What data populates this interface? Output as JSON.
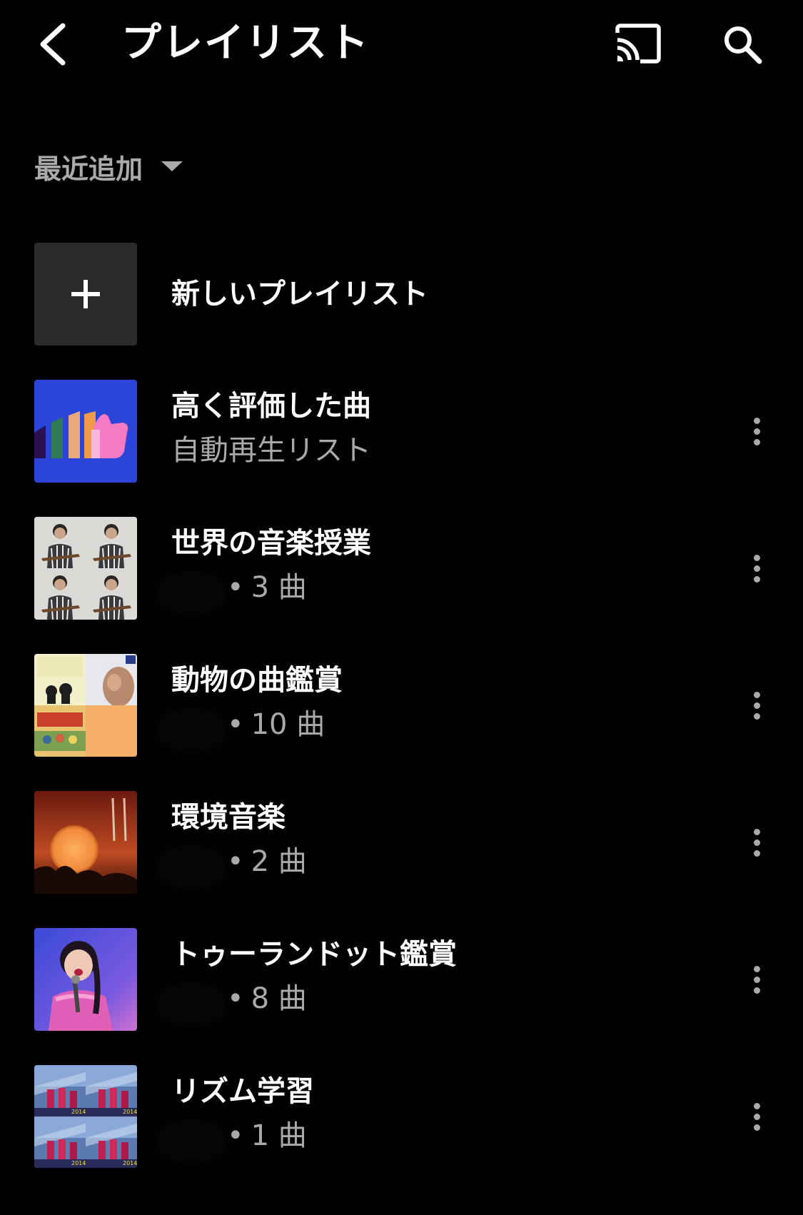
{
  "header": {
    "title": "プレイリスト",
    "back_icon": "back-arrow-icon",
    "cast_icon": "cast-icon",
    "search_icon": "search-icon"
  },
  "sort": {
    "label": "最近追加",
    "icon": "dropdown-caret-icon"
  },
  "new_playlist": {
    "label": "新しいプレイリスト",
    "icon": "plus-icon"
  },
  "playlists": [
    {
      "title": "高く評価した曲",
      "subtitle": "自動再生リスト",
      "owner": "",
      "count": "",
      "thumb": "liked-songs-art"
    },
    {
      "title": "世界の音楽授業",
      "subtitle": "",
      "owner": "T Y",
      "count": "3 曲",
      "thumb": "guitarist-grid"
    },
    {
      "title": "動物の曲鑑賞",
      "subtitle": "",
      "owner": "",
      "count": "10 曲",
      "thumb": "classical-album-grid"
    },
    {
      "title": "環境音楽",
      "subtitle": "",
      "owner": "",
      "count": "2 曲",
      "thumb": "moon-album"
    },
    {
      "title": "トゥーランドット鑑賞",
      "subtitle": "",
      "owner": "",
      "count": "8 曲",
      "thumb": "singer-photo"
    },
    {
      "title": "リズム学習",
      "subtitle": "",
      "owner": "T Y",
      "count": "1 曲",
      "thumb": "stage-grid"
    }
  ],
  "colors": {
    "background": "#000000",
    "secondary_text": "#aaaaaa",
    "new_playlist_tile": "#2a2a2a",
    "liked_tile_bg": "#2b45d8"
  }
}
